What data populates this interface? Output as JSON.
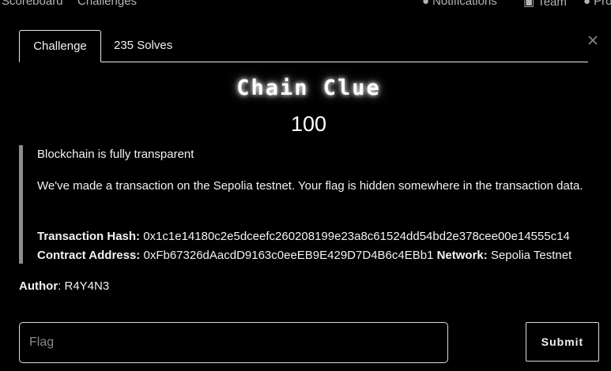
{
  "navbar": {
    "scoreboard": "Scoreboard",
    "challenges": "Challenges",
    "notifications": "Notifications",
    "team": "Team",
    "profile": "Profile",
    "icons": [
      "bell-icon",
      "team-icon",
      "user-icon"
    ]
  },
  "modal": {
    "tabs": [
      {
        "label": "Challenge",
        "active": true
      },
      {
        "label": "235 Solves",
        "active": false
      }
    ],
    "close_icon": "close-icon",
    "title": "Chain Clue",
    "points": "100",
    "description": {
      "line1": "Blockchain is fully transparent",
      "line2": "We've made a transaction on the Sepolia testnet. Your flag is hidden somewhere in the transaction data.",
      "tx_hash_label": "Transaction Hash:",
      "tx_hash_value": " 0x1c1e14180c2e5dceefc260208199e23a8c61524dd54bd2e378cee00e14555c14",
      "contract_label": "Contract Address:",
      "contract_value": " 0xFb67326dAacdD9163c0eeEB9E429D7D4B6c4EBb1 ",
      "network_label": "Network:",
      "network_value": " Sepolia Testnet"
    },
    "author_label": "Author",
    "author_value": ": R4Y4N3",
    "flag_placeholder": "Flag",
    "flag_value": "",
    "submit_label": "Submit"
  },
  "colors": {
    "background": "#000000",
    "text": "#f2f2f2",
    "border": "#e8e8e8",
    "quote_bar": "#8c8c8c",
    "placeholder": "#8a8a8a"
  }
}
